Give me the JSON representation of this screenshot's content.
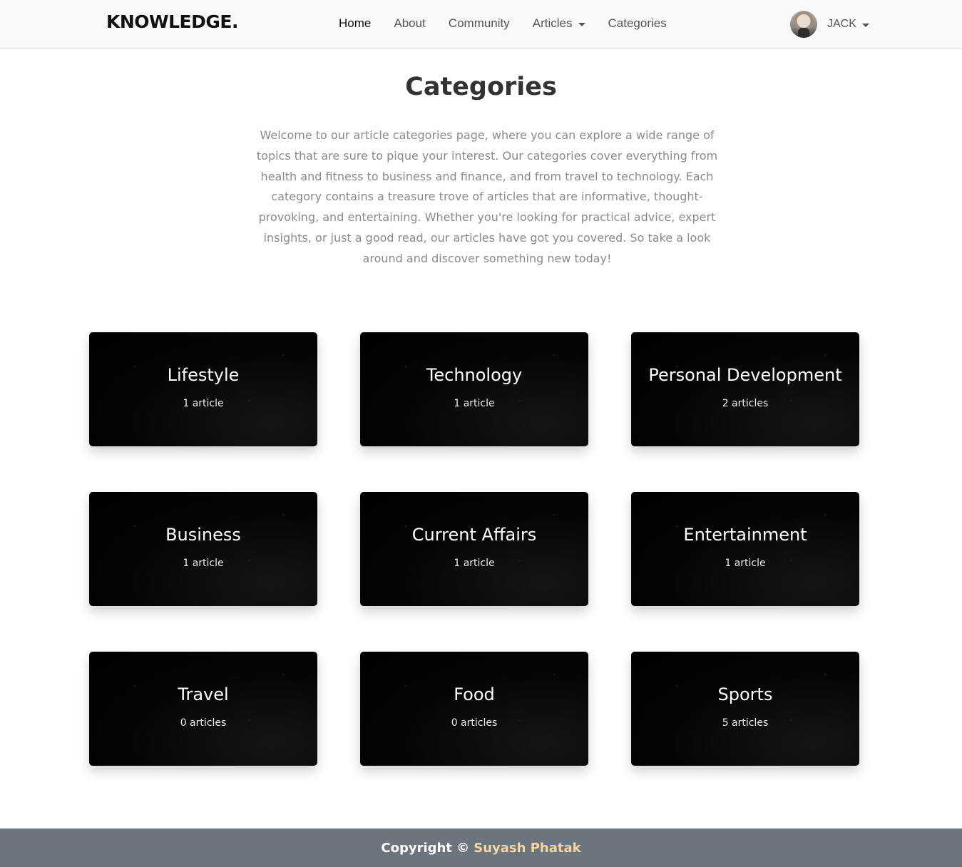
{
  "navbar": {
    "brand": "KNOWLEDGE.",
    "links": [
      {
        "label": "Home"
      },
      {
        "label": "About"
      },
      {
        "label": "Community"
      },
      {
        "label": "Articles"
      },
      {
        "label": "Categories"
      }
    ],
    "user": {
      "name": "JACK"
    }
  },
  "header": {
    "title": "Categories",
    "intro": "Welcome to our article categories page, where you can explore a wide range of topics that are sure to pique your interest. Our categories cover everything from health and fitness to business and finance, and from travel to technology. Each category contains a treasure trove of articles that are informative, thought-provoking, and entertaining. Whether you're looking for practical advice, expert insights, or just a good read, our articles have got you covered. So take a look around and discover something new today!"
  },
  "categories": [
    {
      "name": "Lifestyle",
      "count": "1 article"
    },
    {
      "name": "Technology",
      "count": "1 article"
    },
    {
      "name": "Personal Development",
      "count": "2 articles"
    },
    {
      "name": "Business",
      "count": "1 article"
    },
    {
      "name": "Current Affairs",
      "count": "1 article"
    },
    {
      "name": "Entertainment",
      "count": "1 article"
    },
    {
      "name": "Travel",
      "count": "0 articles"
    },
    {
      "name": "Food",
      "count": "0 articles"
    },
    {
      "name": "Sports",
      "count": "5 articles"
    }
  ],
  "footer": {
    "copyright": "Copyright ©",
    "author": "Suyash Phatak"
  }
}
